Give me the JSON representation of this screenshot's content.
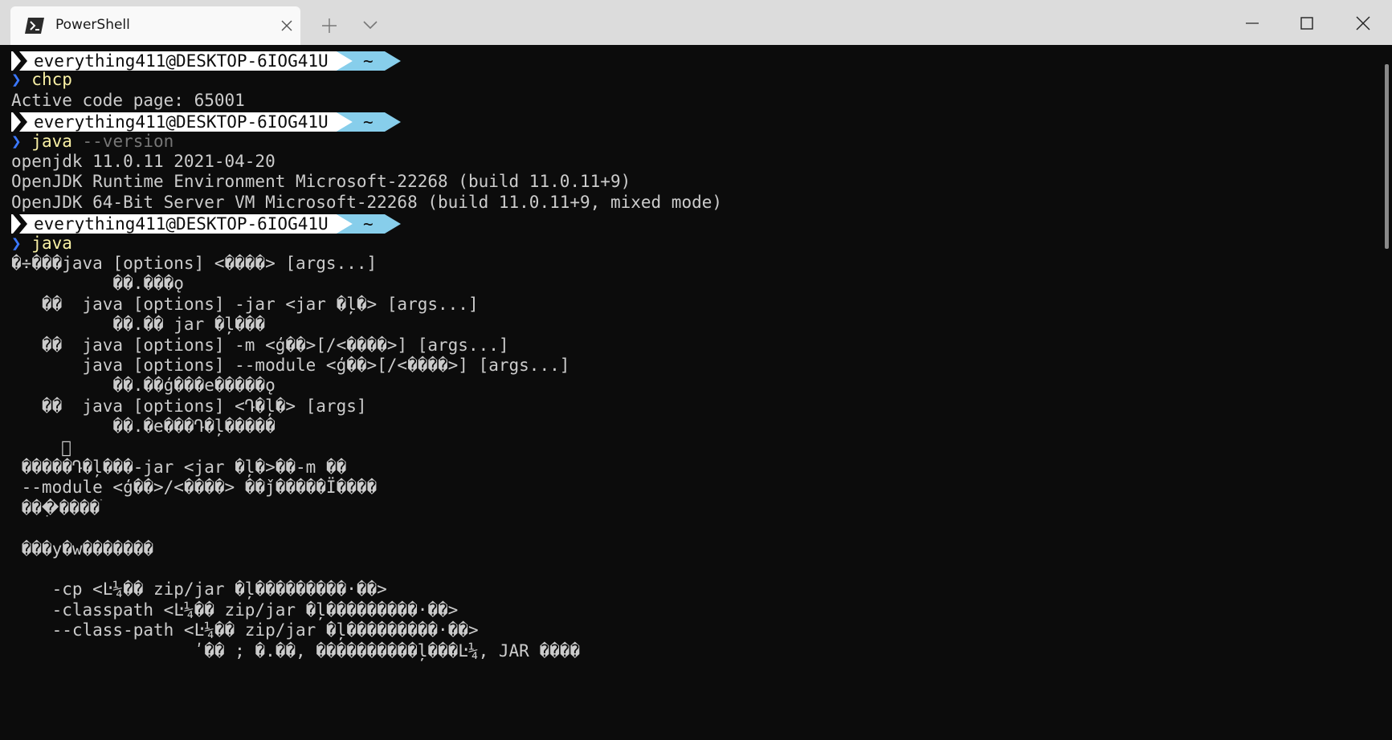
{
  "window": {
    "tab_title": "PowerShell",
    "icons": {
      "tab": "powershell-icon",
      "close_tab": "close-icon",
      "new_tab": "plus-icon",
      "dropdown": "chevron-down-icon",
      "minimize": "minimize-icon",
      "maximize": "maximize-icon",
      "close": "close-icon"
    }
  },
  "colors": {
    "terminal_bg": "#0c0c0c",
    "prompt_user_bg": "#ffffff",
    "prompt_dir_bg": "#87ceeb",
    "caret": "#3b78ff",
    "command": "#f9f1a5",
    "argument": "#767676",
    "output": "#cccccc"
  },
  "prompt": {
    "user": "everything411@DESKTOP-6IOG41U",
    "dir": "~",
    "caret": "❯"
  },
  "session": [
    {
      "command": "chcp",
      "args": "",
      "output": [
        "Active code page: 65001"
      ]
    },
    {
      "command": "java",
      "args": " --version",
      "output": [
        "openjdk 11.0.11 2021-04-20",
        "OpenJDK Runtime Environment Microsoft-22268 (build 11.0.11+9)",
        "OpenJDK 64-Bit Server VM Microsoft-22268 (build 11.0.11+9, mixed mode)"
      ]
    },
    {
      "command": "java",
      "args": "",
      "output": [
        "�÷���java [options] <����> [args...]",
        "          ��.���ǫ",
        "   ��  java [options] -jar <jar �ļ�> [args...]",
        "          ��.�� jar �ļ���",
        "   ��  java [options] -m <ģ��>[/<����>] [args...]",
        "       java [options] --module <ģ��>[/<����>] [args...]",
        "          ��.��ģ���е�����ǫ",
        "   ��  java [options] <Դ�ļ�> [args]",
        "          ��.�е���Դ�ļ�����",
        "",
        " �����֮Դ�ļ���-jar <jar �ļ�>��-m ��",
        " --module <ģ��>/<����> ��ǰ�����Ï����",
        " ���ִ����ۛ",
        "",
        " ���у�w�������",
        "",
        "    -cp <Ŀ¼�� zip/jar �ļ���������·��>",
        "    -classpath <Ŀ¼�� zip/jar �ļ���������·��>",
        "    --class-path <Ŀ¼�� zip/jar �ļ���������·��>",
        "                  ʹ�� ; �.��, ����������ļ���Ŀ¼, JAR ����"
      ]
    }
  ]
}
